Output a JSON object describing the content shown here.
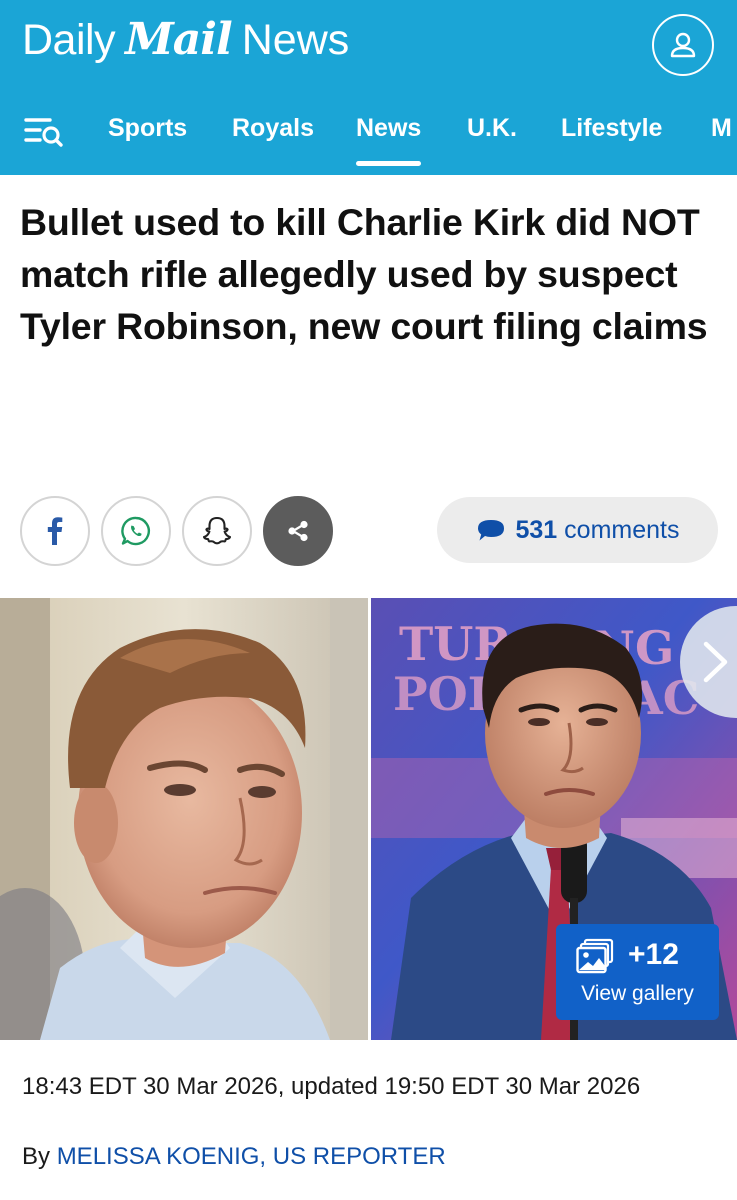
{
  "header": {
    "brand": {
      "daily": "Daily",
      "mail": "Mail",
      "news": "News"
    },
    "account_icon": "user-icon",
    "bg_color": "#1ba5d6"
  },
  "nav": {
    "menu_icon": "menu-search-icon",
    "items": [
      {
        "label": "Sports"
      },
      {
        "label": "Royals"
      },
      {
        "label": "News",
        "active": true
      },
      {
        "label": "U.K."
      },
      {
        "label": "Lifestyle"
      },
      {
        "label": "M"
      }
    ]
  },
  "article": {
    "headline": "Bullet used to kill Charlie Kirk did NOT match rifle allegedly used by suspect Tyler Robinson, new court filing claims",
    "comments": {
      "count": "531",
      "label": "comments",
      "icon": "speech-bubble-icon"
    },
    "share_icons": [
      "facebook-icon",
      "whatsapp-icon",
      "snapchat-icon",
      "share-icon"
    ],
    "gallery": {
      "count": "+12",
      "label": "View gallery",
      "icon": "gallery-icon"
    },
    "backdrop_text": [
      "TUR",
      "NG",
      "POI",
      "AC"
    ],
    "date": "18:43 EDT 30 Mar 2026, updated 19:50 EDT 30 Mar 2026",
    "byline": {
      "prefix": "By",
      "author": "MELISSA KOENIG, US REPORTER"
    },
    "link_color": "#0f4fa8"
  }
}
